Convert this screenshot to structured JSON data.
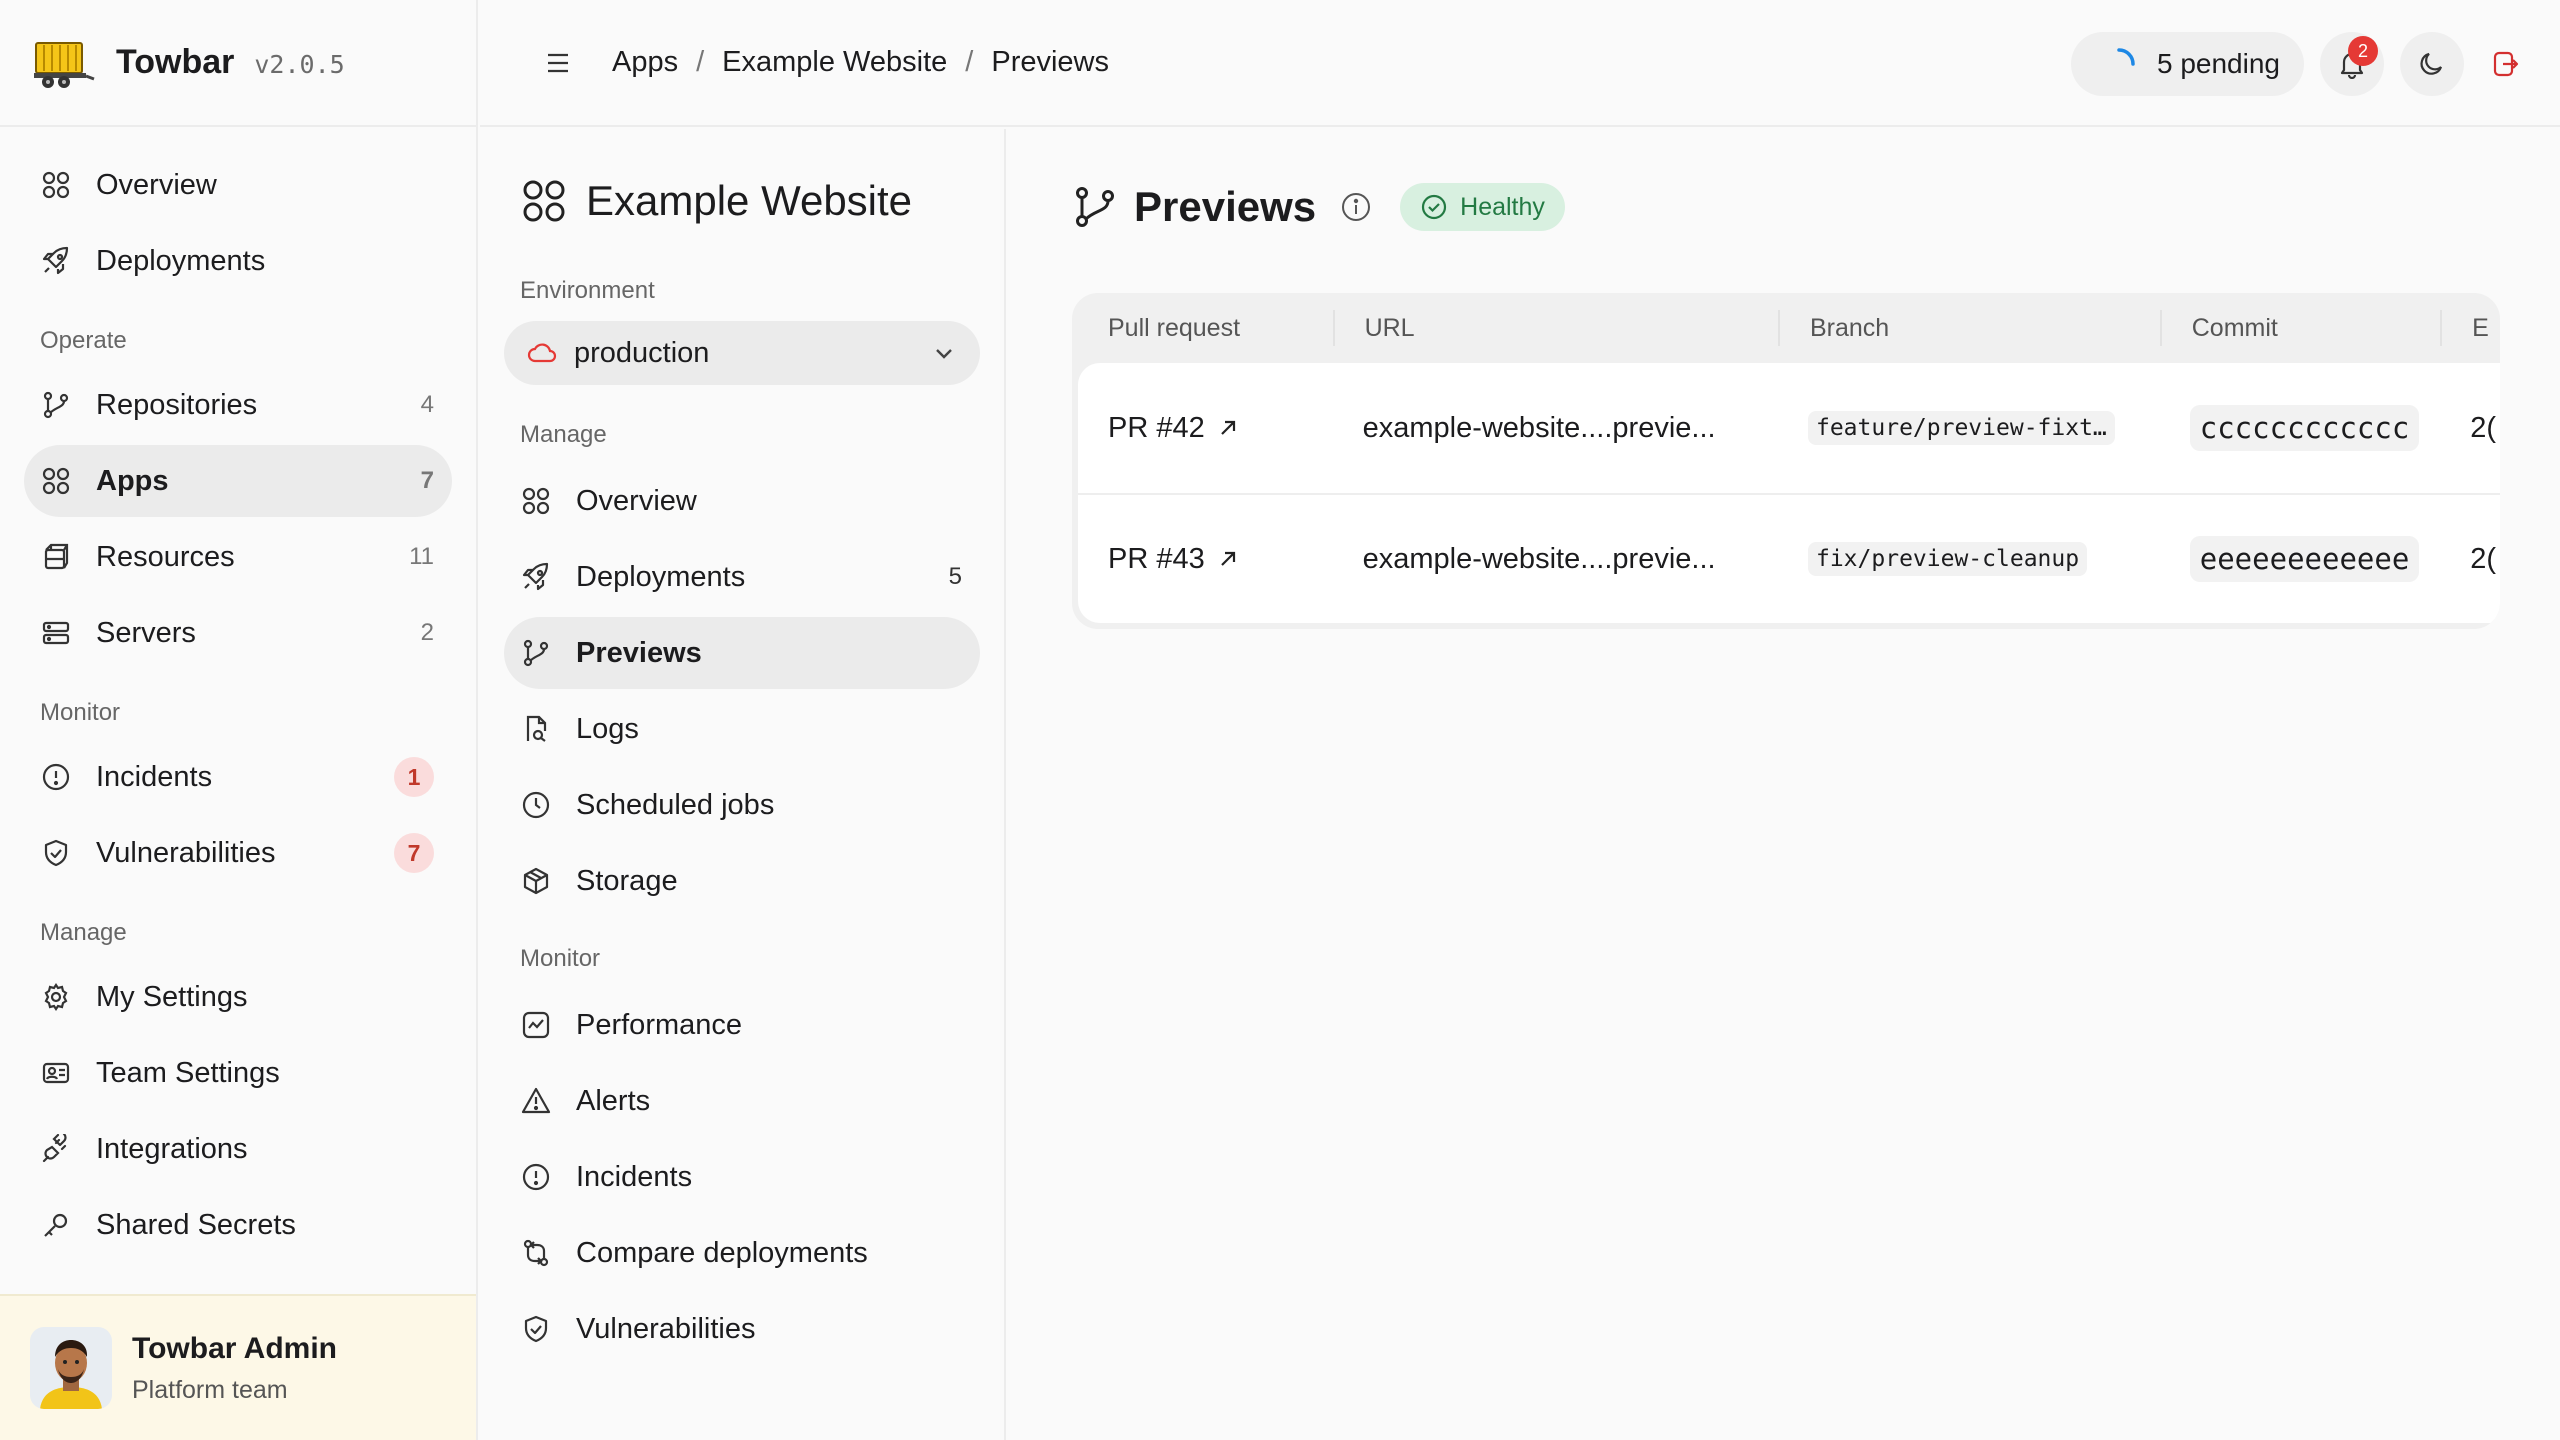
{
  "brand": {
    "name": "Towbar",
    "version": "v2.0.5"
  },
  "sidebar": {
    "top_items": [
      {
        "label": "Overview",
        "icon": "grid-icon"
      },
      {
        "label": "Deployments",
        "icon": "rocket-icon"
      }
    ],
    "operate_label": "Operate",
    "operate_items": [
      {
        "label": "Repositories",
        "count": "4",
        "icon": "git-branch-icon"
      },
      {
        "label": "Apps",
        "count": "7",
        "icon": "grid-icon"
      },
      {
        "label": "Resources",
        "count": "11",
        "icon": "database-icon"
      },
      {
        "label": "Servers",
        "count": "2",
        "icon": "server-icon"
      }
    ],
    "monitor_label": "Monitor",
    "monitor_items": [
      {
        "label": "Incidents",
        "badge": "1",
        "icon": "alert-circle-icon"
      },
      {
        "label": "Vulnerabilities",
        "badge": "7",
        "icon": "shield-icon"
      }
    ],
    "manage_label": "Manage",
    "manage_items": [
      {
        "label": "My Settings",
        "icon": "gear-icon"
      },
      {
        "label": "Team Settings",
        "icon": "id-card-icon"
      },
      {
        "label": "Integrations",
        "icon": "plug-icon"
      },
      {
        "label": "Shared Secrets",
        "icon": "key-icon"
      }
    ]
  },
  "user": {
    "name": "Towbar Admin",
    "team": "Platform team"
  },
  "breadcrumb": [
    "Apps",
    "Example Website",
    "Previews"
  ],
  "topbar": {
    "pending_label": "5 pending",
    "notification_count": "2"
  },
  "subnav": {
    "app_title": "Example Website",
    "environment_label": "Environment",
    "environment_value": "production",
    "manage_label": "Manage",
    "manage_items": [
      {
        "label": "Overview",
        "icon": "grid-icon"
      },
      {
        "label": "Deployments",
        "count": "5",
        "icon": "rocket-icon"
      },
      {
        "label": "Previews",
        "icon": "git-branch-icon"
      },
      {
        "label": "Logs",
        "icon": "file-search-icon"
      },
      {
        "label": "Scheduled jobs",
        "icon": "clock-icon"
      },
      {
        "label": "Storage",
        "icon": "box-icon"
      }
    ],
    "monitor_label": "Monitor",
    "monitor_items": [
      {
        "label": "Performance",
        "icon": "activity-icon"
      },
      {
        "label": "Alerts",
        "icon": "warning-icon"
      },
      {
        "label": "Incidents",
        "icon": "alert-circle-icon"
      },
      {
        "label": "Compare deployments",
        "icon": "compare-icon"
      },
      {
        "label": "Vulnerabilities",
        "icon": "shield-icon"
      }
    ]
  },
  "page": {
    "title": "Previews",
    "status": "Healthy",
    "status_color": "#237a43"
  },
  "table": {
    "headers": [
      "Pull request",
      "URL",
      "Branch",
      "Commit",
      "E"
    ],
    "rows": [
      {
        "pr": "PR #42",
        "url": "example-website....previe...",
        "branch": "feature/preview-fixt…",
        "commit": "cccccccccccc",
        "extra": "2("
      },
      {
        "pr": "PR #43",
        "url": "example-website....previe...",
        "branch": "fix/preview-cleanup",
        "commit": "eeeeeeeeeeee",
        "extra": "2("
      }
    ]
  },
  "colors": {
    "danger": "#e53935",
    "healthy_bg": "#d8f0e0",
    "user_card_bg": "#fdf8e7"
  }
}
